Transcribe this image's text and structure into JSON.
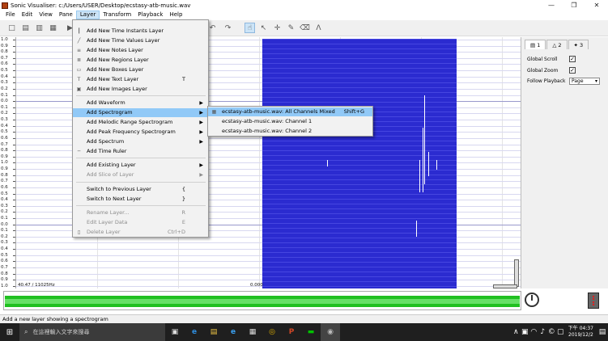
{
  "window": {
    "title": "Sonic Visualiser: c:/Users/USER/Desktop/ecstasy-atb-music.wav",
    "minimize": "—",
    "maximize": "❐",
    "close": "✕"
  },
  "menubar": [
    "File",
    "Edit",
    "View",
    "Pane",
    "Layer",
    "Transform",
    "Playback",
    "Help"
  ],
  "layer_menu": {
    "items": [
      {
        "label": "Add New Time Instants Layer",
        "shortcut": "",
        "icon": "┃"
      },
      {
        "label": "Add New Time Values Layer",
        "shortcut": "",
        "icon": "╱"
      },
      {
        "label": "Add New Notes Layer",
        "shortcut": "",
        "icon": "≡"
      },
      {
        "label": "Add New Regions Layer",
        "shortcut": "",
        "icon": "≣"
      },
      {
        "label": "Add New Boxes Layer",
        "shortcut": "",
        "icon": "▭"
      },
      {
        "label": "Add New Text Layer",
        "shortcut": "T",
        "icon": "T"
      },
      {
        "label": "Add New Images Layer",
        "shortcut": "",
        "icon": "▣"
      },
      {
        "label": "Add Waveform",
        "shortcut": "",
        "icon": ""
      },
      {
        "label": "Add Spectrogram",
        "shortcut": "",
        "icon": ""
      },
      {
        "label": "Add Melodic Range Spectrogram",
        "shortcut": "",
        "icon": ""
      },
      {
        "label": "Add Peak Frequency Spectrogram",
        "shortcut": "",
        "icon": ""
      },
      {
        "label": "Add Spectrum",
        "shortcut": "",
        "icon": ""
      },
      {
        "label": "Add Time Ruler",
        "shortcut": "",
        "icon": "─"
      },
      {
        "label": "Add Existing Layer",
        "shortcut": "",
        "icon": ""
      },
      {
        "label": "Add Slice of Layer",
        "shortcut": "",
        "icon": ""
      },
      {
        "label": "Switch to Previous Layer",
        "shortcut": "{",
        "icon": ""
      },
      {
        "label": "Switch to Next Layer",
        "shortcut": "}",
        "icon": ""
      },
      {
        "label": "Rename Layer...",
        "shortcut": "R",
        "icon": ""
      },
      {
        "label": "Edit Layer Data",
        "shortcut": "E",
        "icon": ""
      },
      {
        "label": "Delete Layer",
        "shortcut": "Ctrl+D",
        "icon": "▯"
      }
    ],
    "arrow": "▶"
  },
  "spectrogram_submenu": {
    "items": [
      {
        "label": "ecstasy-atb-music.wav: All Channels Mixed",
        "shortcut": "Shift+G",
        "icon": "▦"
      },
      {
        "label": "ecstasy-atb-music.wav: Channel 1",
        "shortcut": "",
        "icon": ""
      },
      {
        "label": "ecstasy-atb-music.wav: Channel 2",
        "shortcut": "",
        "icon": ""
      }
    ]
  },
  "toolbar": {
    "icons": [
      "□",
      "▤",
      "▥",
      "▦",
      "▶",
      "↶",
      "↷",
      "☝",
      "↖",
      "✛",
      "✎",
      "⌫",
      "Λ"
    ]
  },
  "ruler": {
    "labels": [
      "1.0",
      "0.9",
      "0.8",
      "0.7",
      "0.6",
      "0.5",
      "0.4",
      "0.3",
      "0.2",
      "0.1",
      "0.0",
      "0.1",
      "0.2",
      "0.3",
      "0.4",
      "0.5",
      "0.6",
      "0.7",
      "0.8",
      "0.9",
      "1.0",
      "0.9",
      "0.8",
      "0.7",
      "0.6",
      "0.5",
      "0.4",
      "0.3",
      "0.2",
      "0.1",
      "0.0",
      "0.1",
      "0.2",
      "0.3",
      "0.4",
      "0.5",
      "0.6",
      "0.7",
      "0.8",
      "0.9",
      "1.0"
    ]
  },
  "pane": {
    "freq_readout": "40.47 / 11025Hz",
    "time_readout": "0.000"
  },
  "properties": {
    "tabs": [
      "▤ 1",
      "△ 2",
      "✦ 3"
    ],
    "global_scroll_label": "Global Scroll",
    "global_zoom_label": "Global Zoom",
    "follow_playback_label": "Follow Playback",
    "follow_playback_value": "Page",
    "check_mark": "✓"
  },
  "status": "Add a new layer showing a spectrogram",
  "taskbar": {
    "search_placeholder": "在這裡輸入文字來搜尋",
    "search_icon": "⌕",
    "start_icon": "⊞",
    "apps": [
      "▣",
      "e",
      "▤",
      "e",
      "▦",
      "◎",
      "P",
      "▬",
      "◉"
    ],
    "time": "下午 04:37",
    "date": "2019/12/2",
    "tray_icons": [
      "∧",
      "▣",
      "◠",
      "♪",
      "©",
      "▢"
    ],
    "notify_icon": "▤"
  }
}
